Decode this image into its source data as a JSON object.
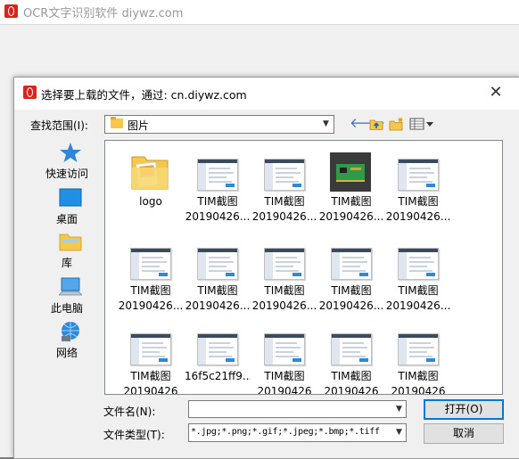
{
  "app": {
    "title": "OCR文字识别软件 diywz.com"
  },
  "dialog": {
    "title": "选择要上载的文件，通过: cn.diywz.com",
    "close_glyph": "✕",
    "lookin_label": "查找范围(I):",
    "lookin_value": "图片",
    "places": [
      {
        "label": "快速访问",
        "icon": "star-icon"
      },
      {
        "label": "桌面",
        "icon": "desktop-icon"
      },
      {
        "label": "库",
        "icon": "library-icon"
      },
      {
        "label": "此电脑",
        "icon": "computer-icon"
      },
      {
        "label": "网络",
        "icon": "network-icon"
      }
    ],
    "files": [
      {
        "line1": "logo",
        "line2": "",
        "kind": "folder"
      },
      {
        "line1": "TIM截图",
        "line2": "20190426...",
        "kind": "shot"
      },
      {
        "line1": "TIM截图",
        "line2": "20190426...",
        "kind": "shot"
      },
      {
        "line1": "TIM截图",
        "line2": "20190426...",
        "kind": "board"
      },
      {
        "line1": "TIM截图",
        "line2": "20190426...",
        "kind": "shot"
      },
      {
        "line1": "TIM截图",
        "line2": "20190426...",
        "kind": "shot"
      },
      {
        "line1": "TIM截图",
        "line2": "20190426...",
        "kind": "shot"
      },
      {
        "line1": "TIM截图",
        "line2": "20190426...",
        "kind": "shot"
      },
      {
        "line1": "TIM截图",
        "line2": "20190426...",
        "kind": "shot"
      },
      {
        "line1": "TIM截图",
        "line2": "20190426...",
        "kind": "shot"
      },
      {
        "line1": "TIM截图",
        "line2": "20190426",
        "kind": "shot"
      },
      {
        "line1": "16f5c21ff9...",
        "line2": "",
        "kind": "shot"
      },
      {
        "line1": "TIM截图",
        "line2": "20190426",
        "kind": "shot"
      },
      {
        "line1": "TIM截图",
        "line2": "20190426",
        "kind": "shot"
      },
      {
        "line1": "TIM截图",
        "line2": "20190426",
        "kind": "shot"
      }
    ],
    "filename_label": "文件名(N):",
    "filename_value": "",
    "filetype_label": "文件类型(T):",
    "filetype_value": "*.jpg;*.png;*.gif;*.jpeg;*.bmp;*.tiff",
    "open_label": "打开(O)",
    "cancel_label": "取消"
  }
}
